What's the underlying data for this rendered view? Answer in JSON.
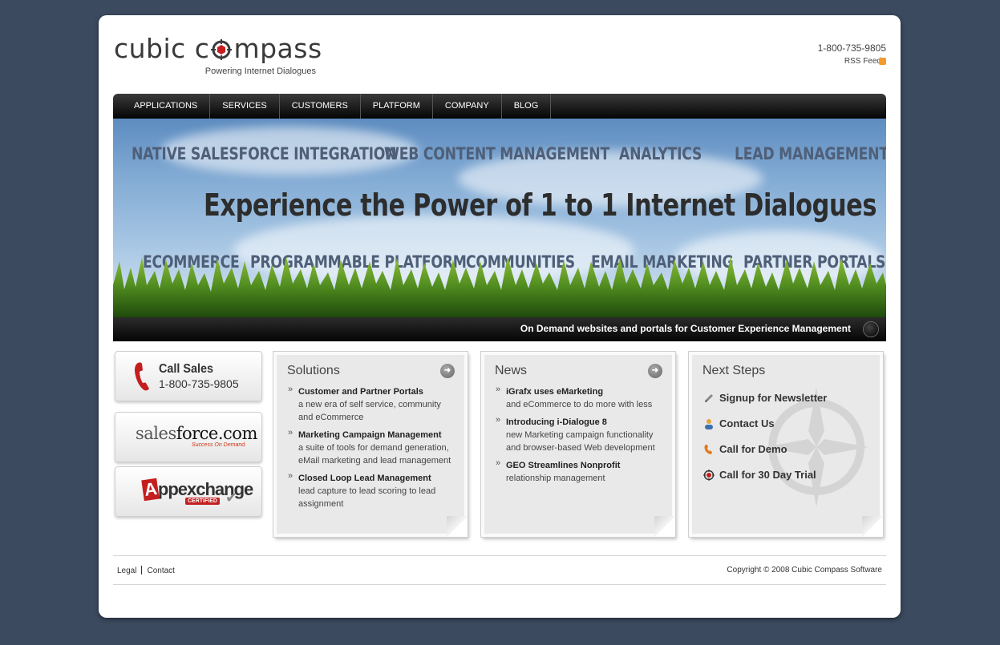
{
  "header": {
    "logo_text_before": "cubic c",
    "logo_text_after": "mpass",
    "tagline": "Powering Internet Dialogues",
    "phone": "1-800-735-9805",
    "rss_label": "RSS Feed"
  },
  "nav": {
    "items": [
      {
        "label": "APPLICATIONS"
      },
      {
        "label": "SERVICES"
      },
      {
        "label": "CUSTOMERS"
      },
      {
        "label": "PLATFORM"
      },
      {
        "label": "COMPANY"
      },
      {
        "label": "BLOG"
      }
    ]
  },
  "hero": {
    "top_words": [
      "NATIVE SALESFORCE INTEGRATION",
      "WEB CONTENT MANAGEMENT",
      "ANALYTICS",
      "LEAD MANAGEMENT"
    ],
    "headline": "Experience the Power of 1 to 1 Internet Dialogues",
    "bottom_words": [
      "ECOMMERCE",
      "PROGRAMMABLE PLATFORM",
      "COMMUNITIES",
      "EMAIL MARKETING",
      "PARTNER PORTALS"
    ],
    "caption": "On Demand websites and portals for Customer Experience Management"
  },
  "sidebar": {
    "call_sales_title": "Call Sales",
    "call_sales_number": "1-800-735-9805",
    "salesforce_logo_sales": "sales",
    "salesforce_logo_force": "force.com",
    "salesforce_tagline": "Success On Demand.",
    "appexchange_logo": "ppexchange",
    "appexchange_a": "A",
    "appexchange_badge": "CERTIFIED"
  },
  "solutions": {
    "title": "Solutions",
    "items": [
      {
        "title": "Customer and Partner Portals",
        "desc": "a new era of self service, community and eCommerce"
      },
      {
        "title": "Marketing Campaign Management",
        "desc": "a suite of tools for demand generation, eMail marketing and lead management"
      },
      {
        "title": "Closed Loop Lead Management",
        "desc": "lead capture to lead scoring to lead assignment"
      }
    ]
  },
  "news": {
    "title": "News",
    "items": [
      {
        "title": "iGrafx uses eMarketing",
        "desc": "and eCommerce to do more with less"
      },
      {
        "title": "Introducing i-Dialogue 8",
        "desc": "new Marketing campaign functionality and browser-based Web development"
      },
      {
        "title": "GEO Streamlines Nonprofit",
        "desc": "relationship management"
      }
    ]
  },
  "next_steps": {
    "title": "Next Steps",
    "items": [
      {
        "label": "Signup for Newsletter",
        "icon": "pencil-icon"
      },
      {
        "label": "Contact Us",
        "icon": "person-icon"
      },
      {
        "label": "Call for Demo",
        "icon": "phone-icon"
      },
      {
        "label": "Call for 30 Day Trial",
        "icon": "target-icon"
      }
    ]
  },
  "footer": {
    "links": [
      {
        "label": "Legal"
      },
      {
        "label": "Contact"
      }
    ],
    "copyright": "Copyright © 2008 Cubic Compass Software"
  },
  "colors": {
    "background": "#3b4a5e",
    "accent_red": "#c41e1e",
    "nav_black": "#050505",
    "rss_orange": "#f39a2a"
  }
}
